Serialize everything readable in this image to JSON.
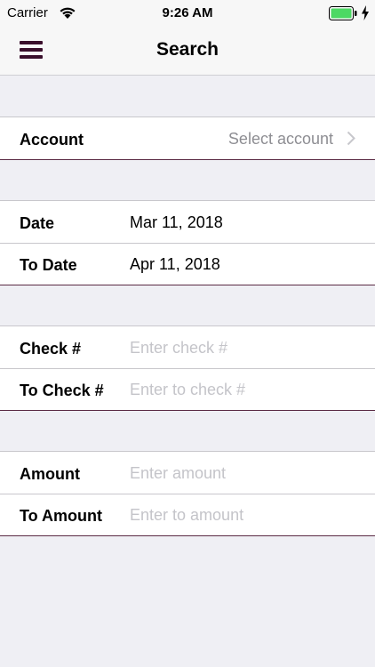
{
  "status_bar": {
    "carrier": "Carrier",
    "time": "9:26 AM",
    "wifi_icon": "wifi-icon",
    "battery_icon": "battery-full-icon",
    "battery_color": "#4cd964",
    "charging_icon": "bolt-icon"
  },
  "nav": {
    "title": "Search",
    "menu_icon": "hamburger-menu-icon",
    "accent_color": "#3a0f2c"
  },
  "account": {
    "label": "Account",
    "value": "Select account",
    "chevron_icon": "chevron-right-icon"
  },
  "dates": {
    "from_label": "Date",
    "from_value": "Mar 11, 2018",
    "to_label": "To Date",
    "to_value": "Apr 11, 2018"
  },
  "checks": {
    "from_label": "Check #",
    "from_placeholder": "Enter check #",
    "to_label": "To Check #",
    "to_placeholder": "Enter to check #"
  },
  "amounts": {
    "from_label": "Amount",
    "from_placeholder": "Enter amount",
    "to_label": "To Amount",
    "to_placeholder": "Enter to amount"
  }
}
